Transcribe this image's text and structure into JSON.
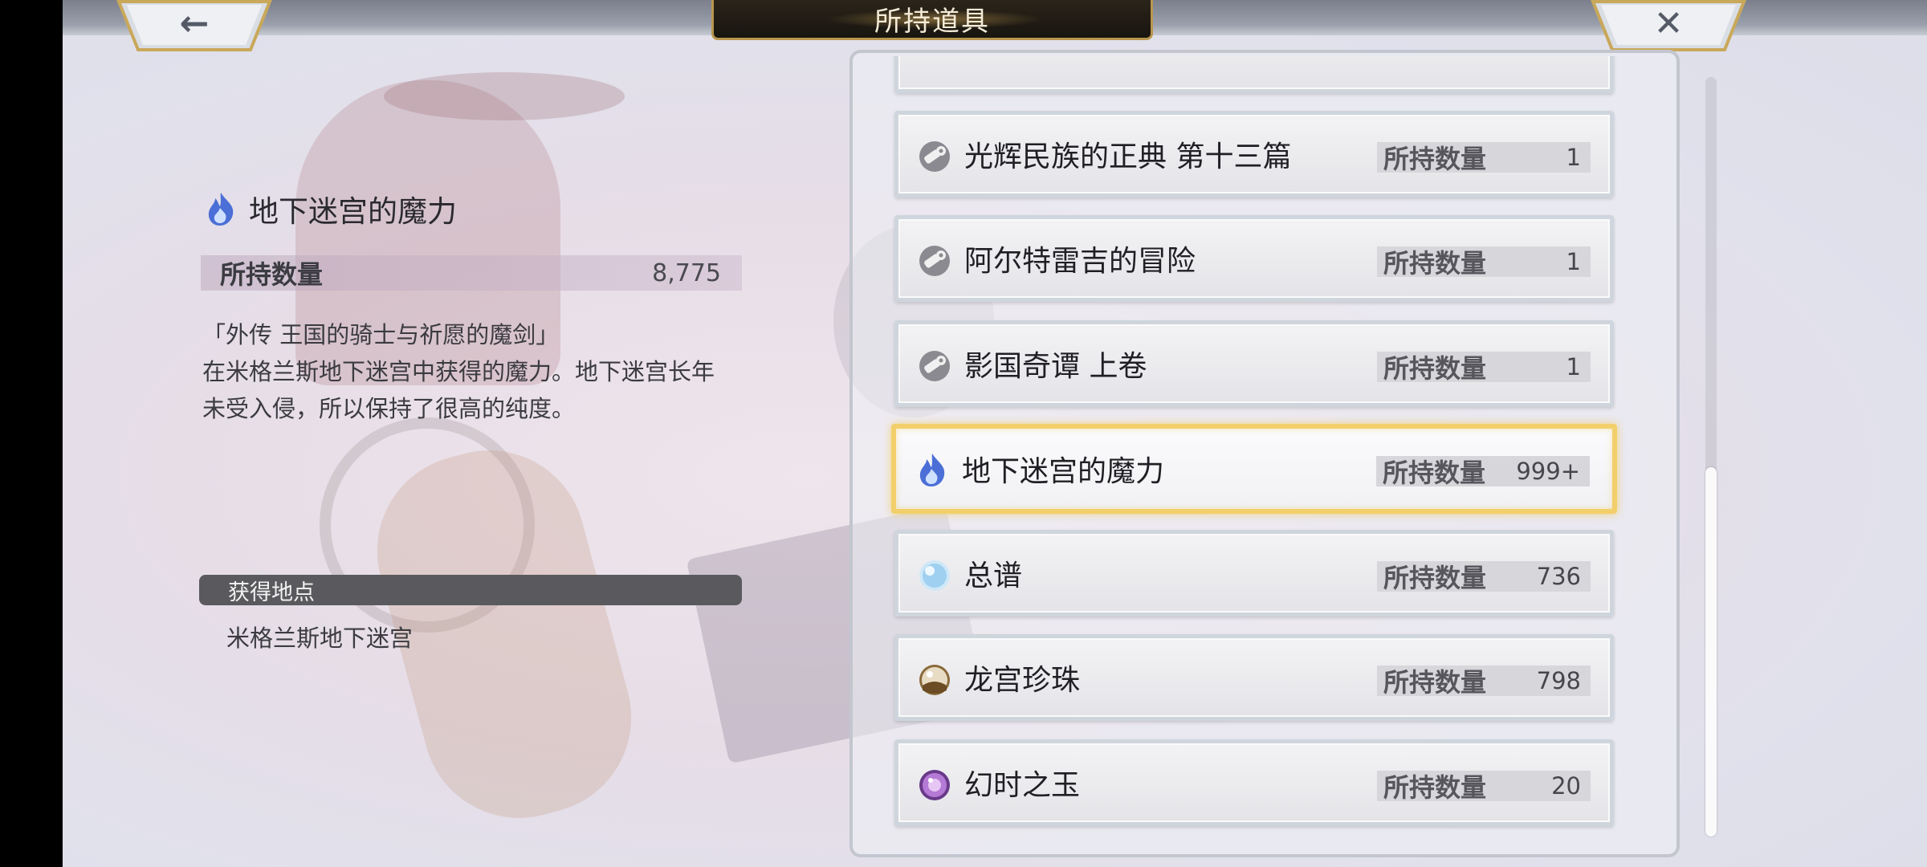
{
  "header": {
    "title": "所持道具",
    "back_glyph": "←",
    "close_glyph": "✕"
  },
  "detail": {
    "icon": "blue-flame-icon",
    "name": "地下迷宫的魔力",
    "owned_label": "所持数量",
    "owned_value": "8,775",
    "description_lines": [
      "「外传 王国的骑士与祈愿的魔剑」",
      "在米格兰斯地下迷宫中获得的魔力。地下迷宫长年",
      "未受入侵，所以保持了很高的纯度。"
    ],
    "location_header": "获得地点",
    "location_value": "米格兰斯地下迷宫"
  },
  "items": [
    {
      "name": "光辉民族的正典 第十三篇",
      "count_label": "所持数量",
      "count": "1",
      "icon": "scroll-key-icon",
      "selected": false
    },
    {
      "name": "阿尔特雷吉的冒险",
      "count_label": "所持数量",
      "count": "1",
      "icon": "scroll-key-icon",
      "selected": false
    },
    {
      "name": "影国奇谭 上卷",
      "count_label": "所持数量",
      "count": "1",
      "icon": "scroll-key-icon",
      "selected": false
    },
    {
      "name": "地下迷宫的魔力",
      "count_label": "所持数量",
      "count": "999+",
      "icon": "blue-flame-icon",
      "selected": true
    },
    {
      "name": "总谱",
      "count_label": "所持数量",
      "count": "736",
      "icon": "light-blue-orb-icon",
      "selected": false
    },
    {
      "name": "龙宫珍珠",
      "count_label": "所持数量",
      "count": "798",
      "icon": "pearl-icon",
      "selected": false
    },
    {
      "name": "幻时之玉",
      "count_label": "所持数量",
      "count": "20",
      "icon": "purple-orb-icon",
      "selected": false
    }
  ],
  "colors": {
    "selected_border": "#f2cf6a",
    "title_plate": "#181510",
    "title_plate_border": "#b8964e"
  }
}
